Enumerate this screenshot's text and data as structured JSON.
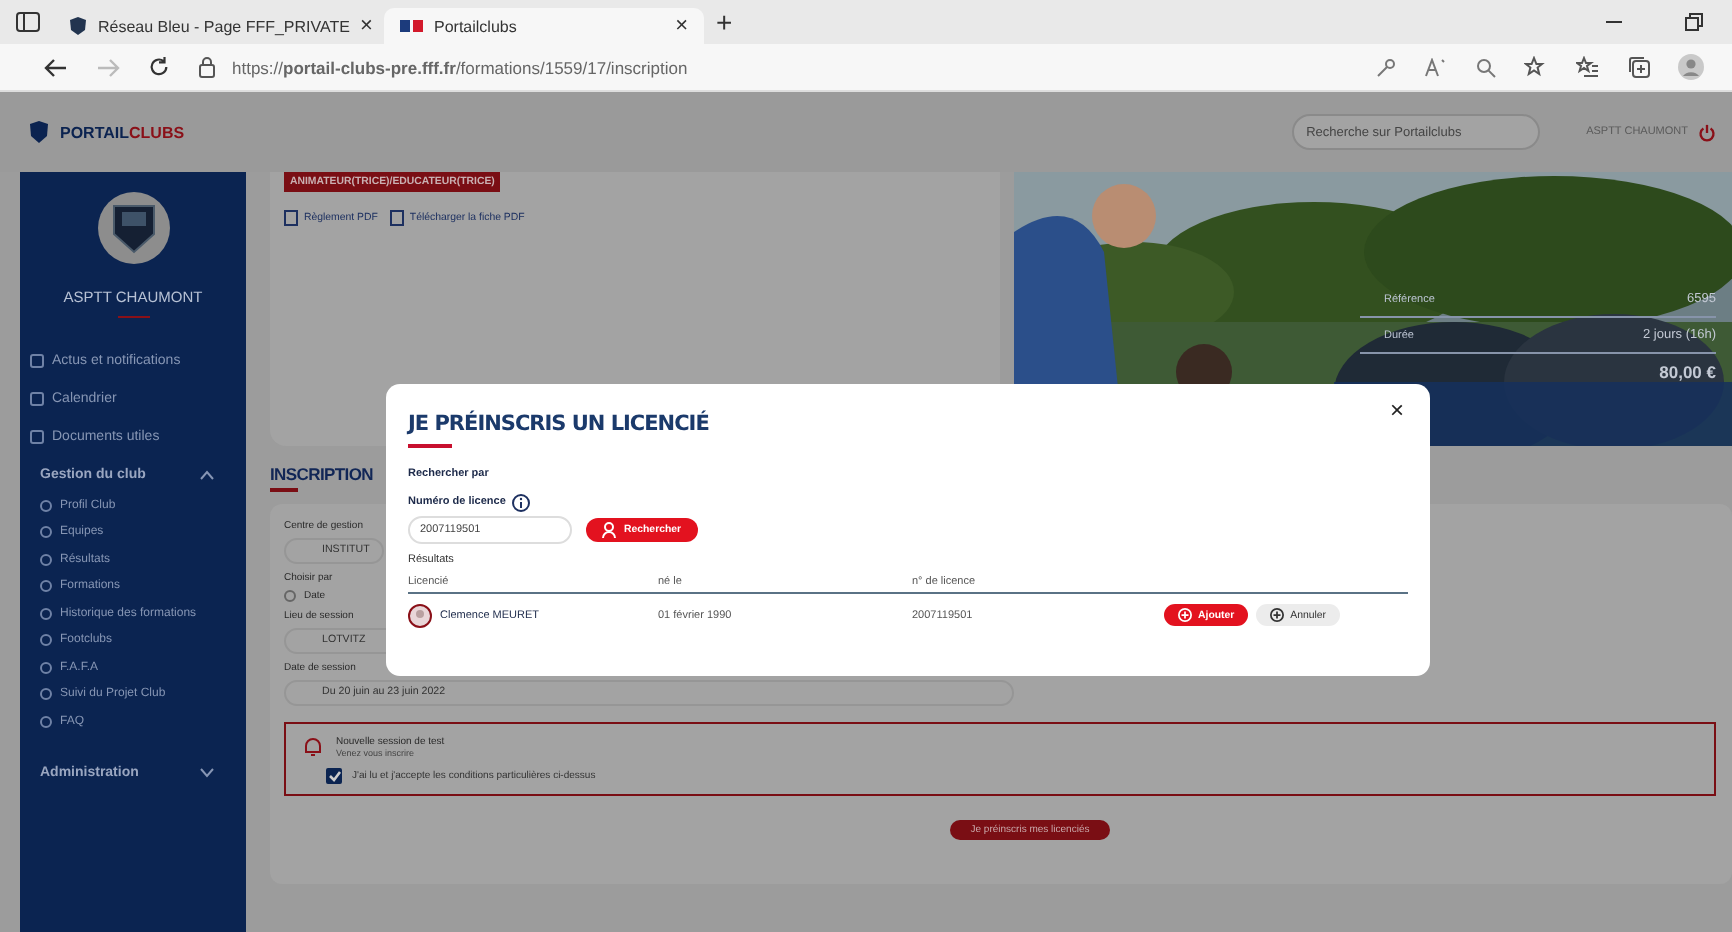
{
  "browser": {
    "tabs": [
      {
        "label": "Réseau Bleu - Page FFF_PRIVATE",
        "selected": false,
        "kind": "blue",
        "close": "×"
      },
      {
        "label": "Portailclubs",
        "selected": true,
        "kind": "pc",
        "close": "×"
      }
    ],
    "new_tab": "+",
    "url": "https://**portail-clubs-pre.fff.fr**/formations/1559/17/inscription"
  },
  "header": {
    "brand": [
      "PORTAIL",
      "CLUBS"
    ],
    "search": {
      "placeholder": "Recherche sur Portailclubs"
    },
    "user": "ASPTT CHAUMONT"
  },
  "sidebar": {
    "club": "ASPTT CHAUMONT",
    "items": [
      {
        "label": "Actus et notifications"
      },
      {
        "label": "Calendrier"
      },
      {
        "label": "Documents utiles"
      }
    ],
    "groups": [
      {
        "label": "Gestion du club",
        "expanded": true,
        "children": [
          {
            "label": "Profil Club"
          },
          {
            "label": "Equipes"
          },
          {
            "label": "Résultats"
          },
          {
            "label": "Formations"
          },
          {
            "label": "Historique des formations"
          },
          {
            "label": "Footclubs"
          },
          {
            "label": "F.A.F.A"
          },
          {
            "label": "Suivi du Projet Club"
          },
          {
            "label": "FAQ"
          }
        ]
      },
      {
        "label": "Administration",
        "expanded": false
      }
    ]
  },
  "formation": {
    "tag": "ANIMATEUR(TRICE)/EDUCATEUR(TRICE)",
    "links": [
      "Règlement PDF",
      "Télécharger la fiche PDF"
    ],
    "info": [
      {
        "label": "Référence",
        "value": "6595"
      },
      {
        "label": "Durée",
        "value": "2 jours (16h)"
      }
    ],
    "price": "80,00 €"
  },
  "inscription": {
    "title": "INSCRIPTION",
    "centre_label": "Centre de gestion",
    "centre_value": "INSTITUT",
    "choose_label": "Choisir par",
    "radios": [
      {
        "label": "Date",
        "selected": false
      }
    ],
    "lieu_label": "Lieu de session",
    "lieu_value": "LOTVITZ",
    "date_label": "Date de session",
    "date_value": "Du 20 juin au 23 juin 2022",
    "alert": {
      "title": "Nouvelle session de test",
      "subtitle": "Venez vous inscrire",
      "accept": "J'ai lu et j'accepte les conditions particulières ci-dessus",
      "checked": true
    },
    "submit": "Je préinscris mes licenciés"
  },
  "modal": {
    "title": "JE PRÉINSCRIS UN LICENCIÉ",
    "close": "×",
    "search_by": "Rechercher par",
    "field_label": "Numéro de licence",
    "field_value": "2007119501",
    "search_button": "Rechercher",
    "results_label": "Résultats",
    "columns": [
      "Licencié",
      "né le",
      "n° de licence"
    ],
    "rows": [
      {
        "name": "Clemence MEURET",
        "born": "01 février 1990",
        "licence": "2007119501",
        "add": "Ajouter",
        "cancel": "Annuler"
      }
    ]
  }
}
